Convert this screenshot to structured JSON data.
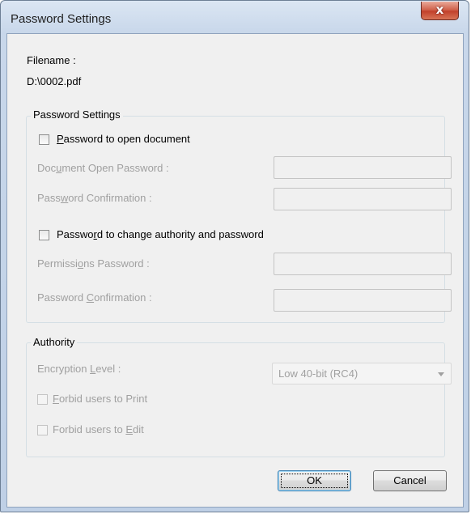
{
  "window": {
    "title": "Password Settings",
    "close_glyph": "x"
  },
  "file": {
    "label": "Filename :",
    "path": "D:\\0002.pdf"
  },
  "password_group": {
    "title": "Password Settings",
    "open_checkbox": {
      "pre": "",
      "u": "P",
      "post": "assword to open document",
      "checked": false
    },
    "open_password": {
      "pre": "Doc",
      "u": "u",
      "post": "ment Open Password :",
      "value": ""
    },
    "open_confirm": {
      "pre": "Pass",
      "u": "w",
      "post": "ord Confirmation :",
      "value": ""
    },
    "change_checkbox": {
      "pre": "Passwo",
      "u": "r",
      "post": "d to change authority and password",
      "checked": false
    },
    "permissions_password": {
      "pre": "Permissi",
      "u": "o",
      "post": "ns Password :",
      "value": ""
    },
    "permissions_confirm": {
      "pre": "Password ",
      "u": "C",
      "post": "onfirmation :",
      "value": ""
    }
  },
  "authority_group": {
    "title": "Authority",
    "encryption": {
      "pre": "Encryption ",
      "u": "L",
      "post": "evel :",
      "selected": "Low 40-bit (RC4)"
    },
    "forbid_print": {
      "pre": "",
      "u": "F",
      "post": "orbid users to Print",
      "checked": false
    },
    "forbid_edit": {
      "pre": "Forbid users to ",
      "u": "E",
      "post": "dit",
      "checked": false
    }
  },
  "buttons": {
    "ok": "OK",
    "cancel": "Cancel"
  },
  "icons": {
    "close": "close-icon",
    "dropdown": "chevron-down-icon"
  },
  "colors": {
    "title_bar": "#c8d7ea",
    "client": "#f0f0f0",
    "close": "#c2412b",
    "disabled_text": "#a0a0a0"
  }
}
